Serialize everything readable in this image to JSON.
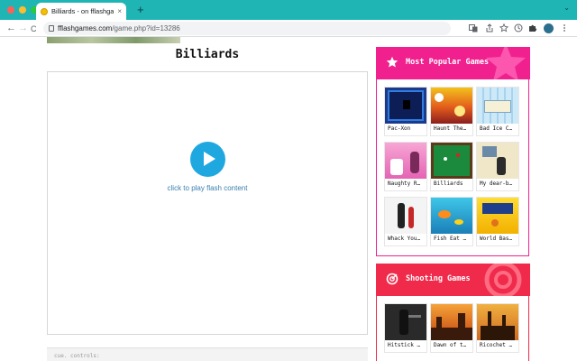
{
  "browser": {
    "tab_title": "Billiards - on fflashgames.com",
    "tab_close": "×",
    "new_tab": "+",
    "tab_menu": "⌄",
    "back": "←",
    "forward": "→",
    "reload": "C",
    "url_host": "fflashgames.com",
    "url_path": "/game.php?id=13286"
  },
  "page": {
    "title": "Billiards",
    "play_label": "click to play flash content",
    "below_text": "cue. controls:"
  },
  "popular": {
    "heading": "Most Popular Games",
    "accent": "#f0218f",
    "games": [
      {
        "name": "Pac-Xon"
      },
      {
        "name": "Haunt The…"
      },
      {
        "name": "Bad Ice C…"
      },
      {
        "name": "Naughty R…"
      },
      {
        "name": "Billiards"
      },
      {
        "name": "My dear-b…"
      },
      {
        "name": "Whack You…"
      },
      {
        "name": "Fish Eat …"
      },
      {
        "name": "World Bas…"
      }
    ]
  },
  "shooting": {
    "heading": "Shooting Games",
    "accent": "#f02a4b",
    "games": [
      {
        "name": "Hitstick …"
      },
      {
        "name": "Dawn of t…"
      },
      {
        "name": "Ricochet …"
      }
    ]
  }
}
